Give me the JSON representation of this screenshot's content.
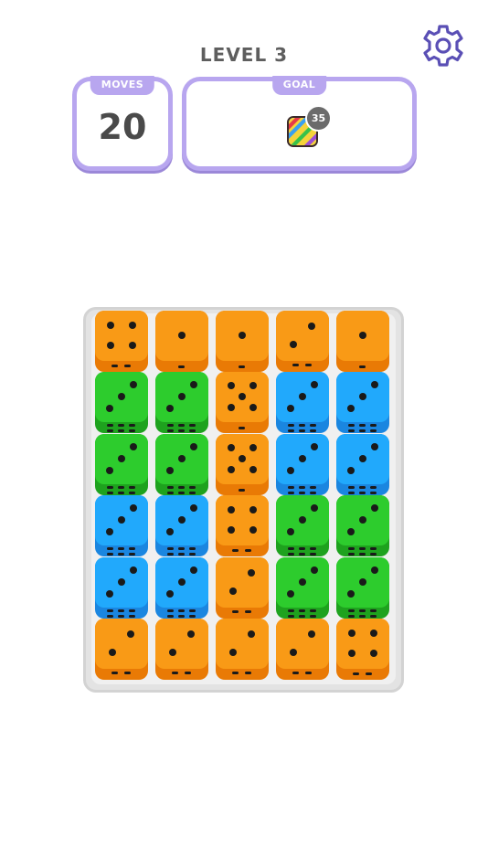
{
  "header": {
    "level_label": "LEVEL 3"
  },
  "moves": {
    "label": "MOVES",
    "value": "20"
  },
  "goal": {
    "label": "GOAL",
    "count": "35",
    "icon": "rainbow-striped-die-icon"
  },
  "settings": {
    "icon": "gear-icon"
  },
  "colors": {
    "panel": "#b8a6ef",
    "orange": "#f99a16",
    "green": "#2dcc2d",
    "blue": "#21a9fc",
    "board": "#e3e3e3"
  },
  "board": {
    "columns": 5,
    "rows": 6,
    "dice": [
      [
        {
          "color": "orange",
          "value": 4
        },
        {
          "color": "orange",
          "value": 1
        },
        {
          "color": "orange",
          "value": 1
        },
        {
          "color": "orange",
          "value": 2
        },
        {
          "color": "orange",
          "value": 1
        }
      ],
      [
        {
          "color": "green",
          "value": 3
        },
        {
          "color": "green",
          "value": 3
        },
        {
          "color": "orange",
          "value": 5
        },
        {
          "color": "blue",
          "value": 3
        },
        {
          "color": "blue",
          "value": 3
        }
      ],
      [
        {
          "color": "green",
          "value": 3
        },
        {
          "color": "green",
          "value": 3
        },
        {
          "color": "orange",
          "value": 5
        },
        {
          "color": "blue",
          "value": 3
        },
        {
          "color": "blue",
          "value": 3
        }
      ],
      [
        {
          "color": "blue",
          "value": 3
        },
        {
          "color": "blue",
          "value": 3
        },
        {
          "color": "orange",
          "value": 4
        },
        {
          "color": "green",
          "value": 3
        },
        {
          "color": "green",
          "value": 3
        }
      ],
      [
        {
          "color": "blue",
          "value": 3
        },
        {
          "color": "blue",
          "value": 3
        },
        {
          "color": "orange",
          "value": 2
        },
        {
          "color": "green",
          "value": 3
        },
        {
          "color": "green",
          "value": 3
        }
      ],
      [
        {
          "color": "orange",
          "value": 2
        },
        {
          "color": "orange",
          "value": 2
        },
        {
          "color": "orange",
          "value": 2
        },
        {
          "color": "orange",
          "value": 2
        },
        {
          "color": "orange",
          "value": 4
        }
      ]
    ]
  }
}
